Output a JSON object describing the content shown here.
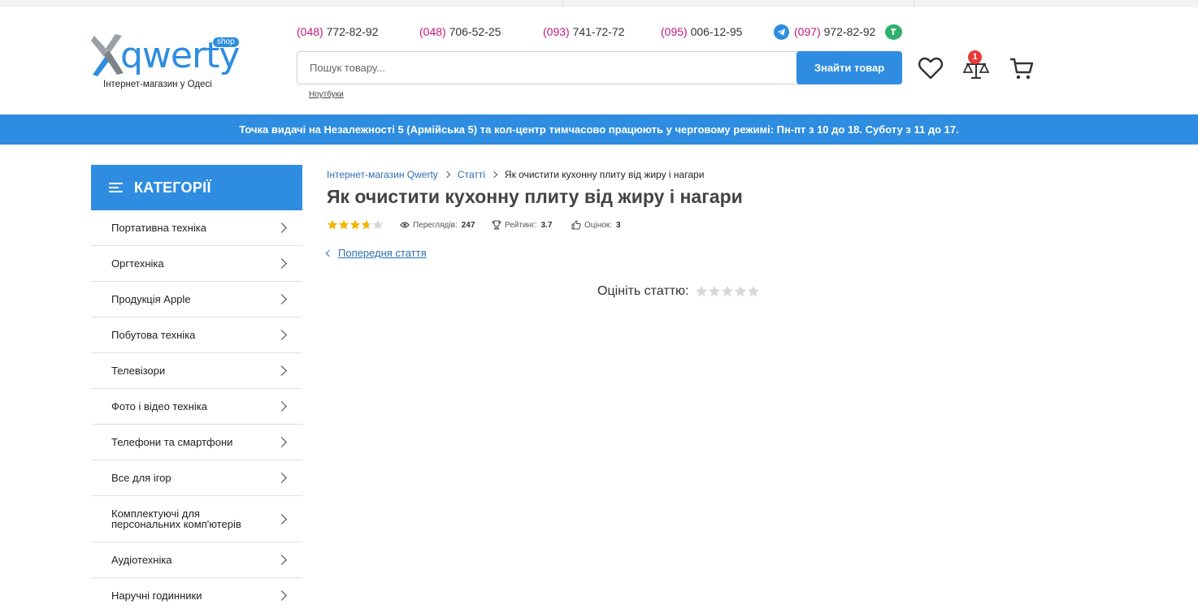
{
  "colors": {
    "accent": "#2e8de0",
    "phone_code": "#c2187a",
    "star_filled": "#f5b400",
    "star_empty": "#d8d8d8",
    "badge": "#e53935"
  },
  "logo": {
    "word": "qwerty",
    "shop": "shop",
    "tagline": "Інтернет-магазин у Одесі"
  },
  "phones": [
    {
      "code": "(048)",
      "number": " 772-82-92"
    },
    {
      "code": "(048)",
      "number": " 706-52-25"
    },
    {
      "code": "(093)",
      "number": " 741-72-72"
    },
    {
      "code": "(095)",
      "number": " 006-12-95"
    },
    {
      "code": "(097)",
      "number": " 972-82-92"
    }
  ],
  "messenger_icons": [
    "telegram-icon",
    "viber-icon"
  ],
  "search": {
    "placeholder": "Пошук товару...",
    "button": "Знайти товар",
    "hint": "Ноутбуки"
  },
  "header_icons": {
    "wishlist": "heart-icon",
    "compare": "scales-icon",
    "compare_count": "1",
    "cart": "cart-icon"
  },
  "notice": "Точка видачі на Незалежності 5 (Армійська 5) та кол-центр тимчасово працюють у черговому режимі: Пн-пт з 10 до 18. Суботу з 11 до 17.",
  "sidebar": {
    "title": "КАТЕГОРІЇ",
    "items": [
      "Портативна техніка",
      "Оргтехніка",
      "Продукція Apple",
      "Побутова техніка",
      "Телевізори",
      "Фото і відео техніка",
      "Телефони та смартфони",
      "Все для ігор",
      "Комплектуючі для персональних комп'ютерів",
      "Аудіотехніка",
      "Наручні годинники"
    ]
  },
  "breadcrumbs": [
    "Інтернет-магазин Qwerty",
    "Статті",
    "Як очистити кухонну плиту від жиру і нагари"
  ],
  "article": {
    "title": "Як очистити кухонну плиту від жиру і нагари",
    "rating_stars": 3.7,
    "views_label": "Переглядів:",
    "views": "247",
    "rating_label": "Рейтинг:",
    "rating": "3.7",
    "votes_label": "Оцінок:",
    "votes": "3",
    "prev_link": "Попередня стаття",
    "rate_prompt": "Оцініть статтю:",
    "user_rating": 0
  }
}
